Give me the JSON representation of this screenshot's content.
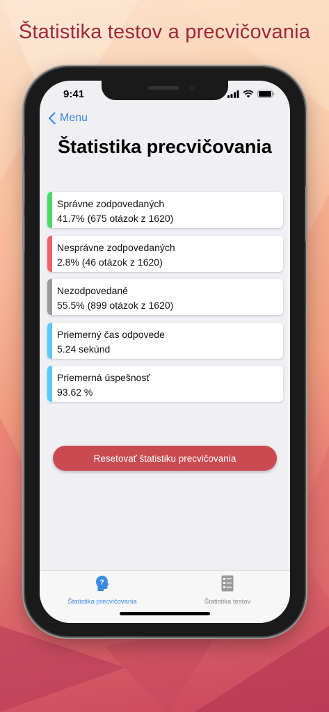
{
  "promo": {
    "title": "Štatistika testov a precvičovania"
  },
  "status_bar": {
    "time": "9:41"
  },
  "nav": {
    "back_label": "Menu"
  },
  "page": {
    "title": "Štatistika precvičovania"
  },
  "stats": [
    {
      "label": "Správne zodpovedaných",
      "value": "41.7% (675 otázok z 1620)",
      "color": "#4cd964"
    },
    {
      "label": "Nesprávne zodpovedaných",
      "value": "2.8% (46 otázok z 1620)",
      "color": "#f0626a"
    },
    {
      "label": "Nezodpovedané",
      "value": "55.5% (899 otázok z 1620)",
      "color": "#9a9a9a"
    },
    {
      "label": "Priemerný čas odpovede",
      "value": "5.24 sekúnd",
      "color": "#5ac8fa"
    },
    {
      "label": "Priemerná úspešnosť",
      "value": "93.62 %",
      "color": "#5ac8fa"
    }
  ],
  "reset_button": {
    "label": "Resetovať štatistiku precvičovania",
    "color": "#c94a50"
  },
  "tabbar": {
    "tabs": [
      {
        "label": "Štatistika precvičovania",
        "icon": "head-question-icon",
        "active": true
      },
      {
        "label": "Štatistika testov",
        "icon": "list-document-icon",
        "active": false
      }
    ]
  },
  "colors": {
    "accent": "#3c8ae0",
    "promo_title": "#a0283f"
  }
}
